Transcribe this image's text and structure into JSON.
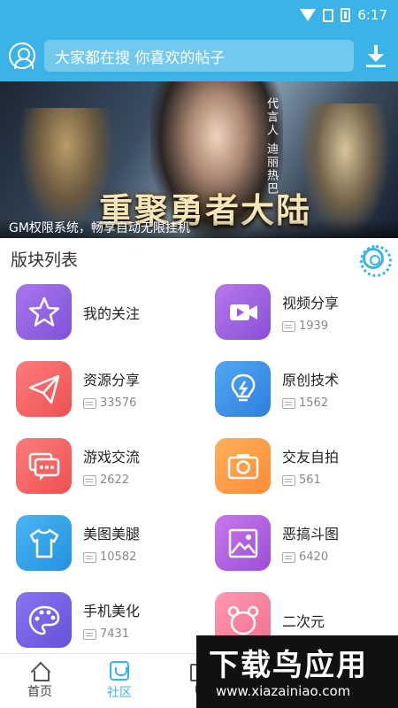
{
  "status": {
    "time": "6:17"
  },
  "header": {
    "search_placeholder": "大家都在搜 你喜欢的帖子"
  },
  "banner": {
    "caption": "GM权限系统，畅享自动无限挂机",
    "headline": "重聚勇者大陆",
    "side_text": "代言人 迪丽热巴"
  },
  "section": {
    "title": "版块列表"
  },
  "boards": [
    {
      "name": "我的关注",
      "count": "",
      "icon": "star-icon",
      "color": "#8f63e3"
    },
    {
      "name": "视频分享",
      "count": "1939",
      "icon": "video-icon",
      "color": "#9b5ee0"
    },
    {
      "name": "资源分享",
      "count": "33576",
      "icon": "paper-plane-icon",
      "color": "#f56464"
    },
    {
      "name": "原创技术",
      "count": "1562",
      "icon": "lightbulb-icon",
      "color": "#3f92e8"
    },
    {
      "name": "游戏交流",
      "count": "2622",
      "icon": "chat-icon",
      "color": "#f56464"
    },
    {
      "name": "交友自拍",
      "count": "561",
      "icon": "camera-icon",
      "color": "#ff9a45"
    },
    {
      "name": "美图美腿",
      "count": "10582",
      "icon": "tshirt-icon",
      "color": "#35a4ea"
    },
    {
      "name": "恶搞斗图",
      "count": "6420",
      "icon": "image-icon",
      "color": "#b463e1"
    },
    {
      "name": "手机美化",
      "count": "7431",
      "icon": "palette-icon",
      "color": "#7663e4"
    },
    {
      "name": "二次元",
      "count": "",
      "icon": "bear-icon",
      "color": "#f7829e"
    }
  ],
  "nav": [
    {
      "label": "首页",
      "icon": "home-icon"
    },
    {
      "label": "社区",
      "icon": "community-icon"
    },
    {
      "label": "U",
      "icon": "grid-icon"
    }
  ],
  "watermark": {
    "title": "下载鸟应用",
    "url": "www.xiazainiao.com"
  }
}
